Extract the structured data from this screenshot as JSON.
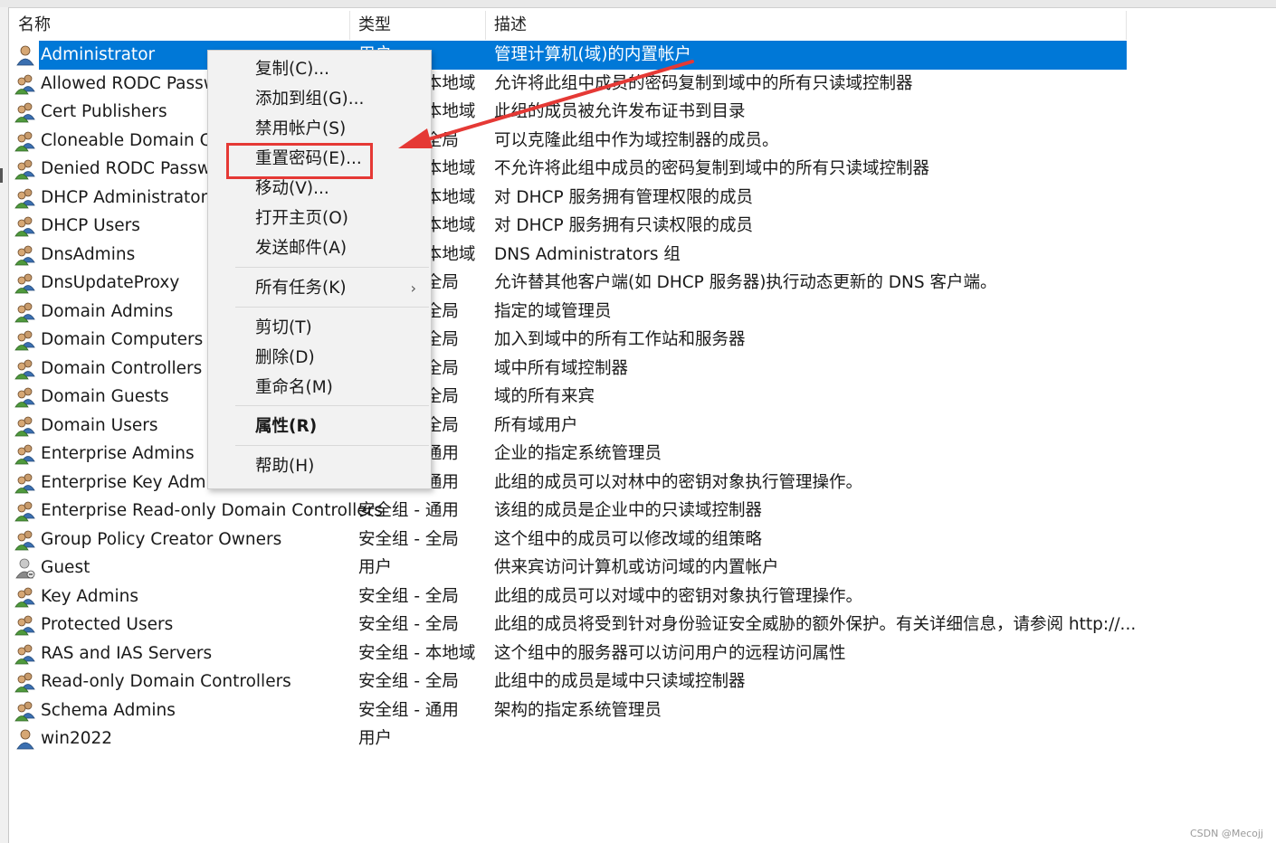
{
  "columns": {
    "name": "名称",
    "type": "类型",
    "desc": "描述"
  },
  "rows": [
    {
      "name": "Administrator",
      "type": "用户",
      "desc": "管理计算机(域)的内置帐户",
      "icon": "user-icon",
      "selected": true
    },
    {
      "name": "Allowed RODC Password Replication Group",
      "type": "安全组 - 本地域",
      "desc": "允许将此组中成员的密码复制到域中的所有只读域控制器",
      "icon": "group-icon"
    },
    {
      "name": "Cert Publishers",
      "type": "安全组 - 本地域",
      "desc": "此组的成员被允许发布证书到目录",
      "icon": "group-icon"
    },
    {
      "name": "Cloneable Domain Controllers",
      "type": "安全组 - 全局",
      "desc": "可以克隆此组中作为域控制器的成员。",
      "icon": "group-icon"
    },
    {
      "name": "Denied RODC Password Replication Group",
      "type": "安全组 - 本地域",
      "desc": "不允许将此组中成员的密码复制到域中的所有只读域控制器",
      "icon": "group-icon"
    },
    {
      "name": "DHCP Administrators",
      "type": "安全组 - 本地域",
      "desc": "对 DHCP 服务拥有管理权限的成员",
      "icon": "group-icon"
    },
    {
      "name": "DHCP Users",
      "type": "安全组 - 本地域",
      "desc": "对 DHCP 服务拥有只读权限的成员",
      "icon": "group-icon"
    },
    {
      "name": "DnsAdmins",
      "type": "安全组 - 本地域",
      "desc": "DNS Administrators 组",
      "icon": "group-icon"
    },
    {
      "name": "DnsUpdateProxy",
      "type": "安全组 - 全局",
      "desc": "允许替其他客户端(如 DHCP 服务器)执行动态更新的 DNS 客户端。",
      "icon": "group-icon"
    },
    {
      "name": "Domain Admins",
      "type": "安全组 - 全局",
      "desc": "指定的域管理员",
      "icon": "group-icon"
    },
    {
      "name": "Domain Computers",
      "type": "安全组 - 全局",
      "desc": "加入到域中的所有工作站和服务器",
      "icon": "group-icon"
    },
    {
      "name": "Domain Controllers",
      "type": "安全组 - 全局",
      "desc": "域中所有域控制器",
      "icon": "group-icon"
    },
    {
      "name": "Domain Guests",
      "type": "安全组 - 全局",
      "desc": "域的所有来宾",
      "icon": "group-icon"
    },
    {
      "name": "Domain Users",
      "type": "安全组 - 全局",
      "desc": "所有域用户",
      "icon": "group-icon"
    },
    {
      "name": "Enterprise Admins",
      "type": "安全组 - 通用",
      "desc": "企业的指定系统管理员",
      "icon": "group-icon"
    },
    {
      "name": "Enterprise Key Admins",
      "type": "安全组 - 通用",
      "desc": "此组的成员可以对林中的密钥对象执行管理操作。",
      "icon": "group-icon"
    },
    {
      "name": "Enterprise Read-only Domain Controllers",
      "type": "安全组 - 通用",
      "desc": "该组的成员是企业中的只读域控制器",
      "icon": "group-icon"
    },
    {
      "name": "Group Policy Creator Owners",
      "type": "安全组 - 全局",
      "desc": "这个组中的成员可以修改域的组策略",
      "icon": "group-icon"
    },
    {
      "name": "Guest",
      "type": "用户",
      "desc": "供来宾访问计算机或访问域的内置帐户",
      "icon": "guest-icon"
    },
    {
      "name": "Key Admins",
      "type": "安全组 - 全局",
      "desc": "此组的成员可以对域中的密钥对象执行管理操作。",
      "icon": "group-icon"
    },
    {
      "name": "Protected Users",
      "type": "安全组 - 全局",
      "desc": "此组的成员将受到针对身份验证安全威胁的额外保护。有关详细信息，请参阅 http://...",
      "icon": "group-icon"
    },
    {
      "name": "RAS and IAS Servers",
      "type": "安全组 - 本地域",
      "desc": "这个组中的服务器可以访问用户的远程访问属性",
      "icon": "group-icon"
    },
    {
      "name": "Read-only Domain Controllers",
      "type": "安全组 - 全局",
      "desc": "此组中的成员是域中只读域控制器",
      "icon": "group-icon"
    },
    {
      "name": "Schema Admins",
      "type": "安全组 - 通用",
      "desc": "架构的指定系统管理员",
      "icon": "group-icon"
    },
    {
      "name": "win2022",
      "type": "用户",
      "desc": "",
      "icon": "user-icon"
    }
  ],
  "context_menu": {
    "copy": "复制(C)...",
    "add_to_group": "添加到组(G)...",
    "disable_account": "禁用帐户(S)",
    "reset_password": "重置密码(E)...",
    "move": "移动(V)...",
    "open_home_page": "打开主页(O)",
    "send_mail": "发送邮件(A)",
    "all_tasks": "所有任务(K)",
    "cut": "剪切(T)",
    "delete": "删除(D)",
    "rename": "重命名(M)",
    "properties": "属性(R)",
    "help": "帮助(H)"
  },
  "annotation_color": "#e53935",
  "selection_color": "#0078d7",
  "watermark": "CSDN @Mecojj"
}
